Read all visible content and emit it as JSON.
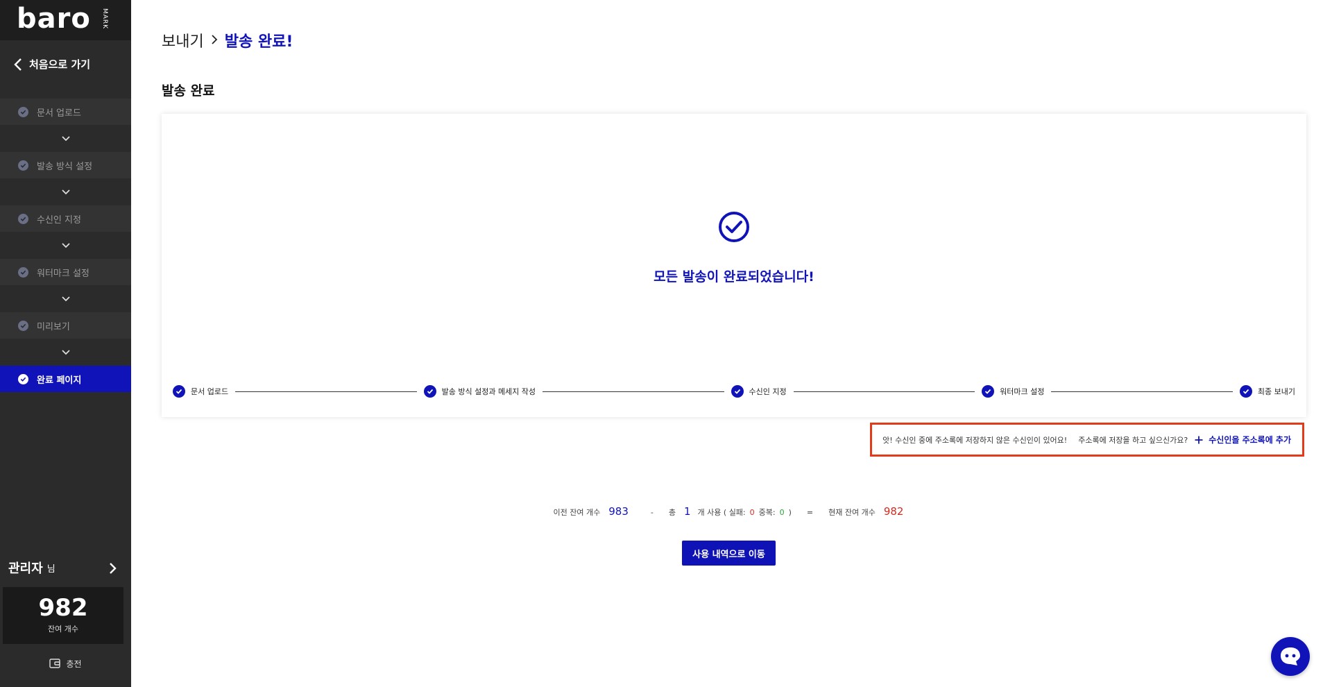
{
  "sidebar": {
    "logo": "baro",
    "logo_sub": "MARK",
    "back_label": "처음으로 가기",
    "steps": [
      {
        "label": "문서 업로드",
        "active": false
      },
      {
        "label": "발송 방식 설정",
        "active": false
      },
      {
        "label": "수신인 지정",
        "active": false
      },
      {
        "label": "워터마크 설정",
        "active": false
      },
      {
        "label": "미리보기",
        "active": false
      },
      {
        "label": "완료 페이지",
        "active": true
      }
    ],
    "user_name": "관리자",
    "user_suffix": "님",
    "balance": "982",
    "balance_label": "잔여 개수",
    "charge_label": "충전"
  },
  "main": {
    "breadcrumb_root": "보내기",
    "breadcrumb_current": "발송 완료!",
    "section_title": "발송 완료",
    "done_message": "모든 발송이 완료되었습니다!",
    "progress": [
      "문서 업로드",
      "발송 방식 설정과 메세지 작성",
      "수신인 지정",
      "워터마크 설정",
      "최종 보내기"
    ],
    "notice": {
      "text_a": "앗! 수신인 중에 주소록에 저장하지 않은 수신인이 있어요!",
      "text_b": "주소록에 저장을 하고 싶으신가요?",
      "add_label": "수신인을 주소록에 추가"
    },
    "summary": {
      "prev_label": "이전 잔여 개수",
      "prev_value": "983",
      "minus": "-",
      "total_label": "총",
      "total_value": "1",
      "usage_label": "개 사용 ( 실패:",
      "fail_value": "0",
      "dup_label": "중복:",
      "dup_value": "0",
      "close_paren": ")",
      "equals": "=",
      "current_label": "현재 잔여 개수",
      "current_value": "982"
    },
    "history_button": "사용 내역으로 이동"
  },
  "colors": {
    "accent": "#1014b8",
    "sidebar_bg": "#2b2b2b",
    "highlight_border": "#e23b1a",
    "fail_red": "#d22b1f",
    "dup_green": "#2a9d3b"
  }
}
